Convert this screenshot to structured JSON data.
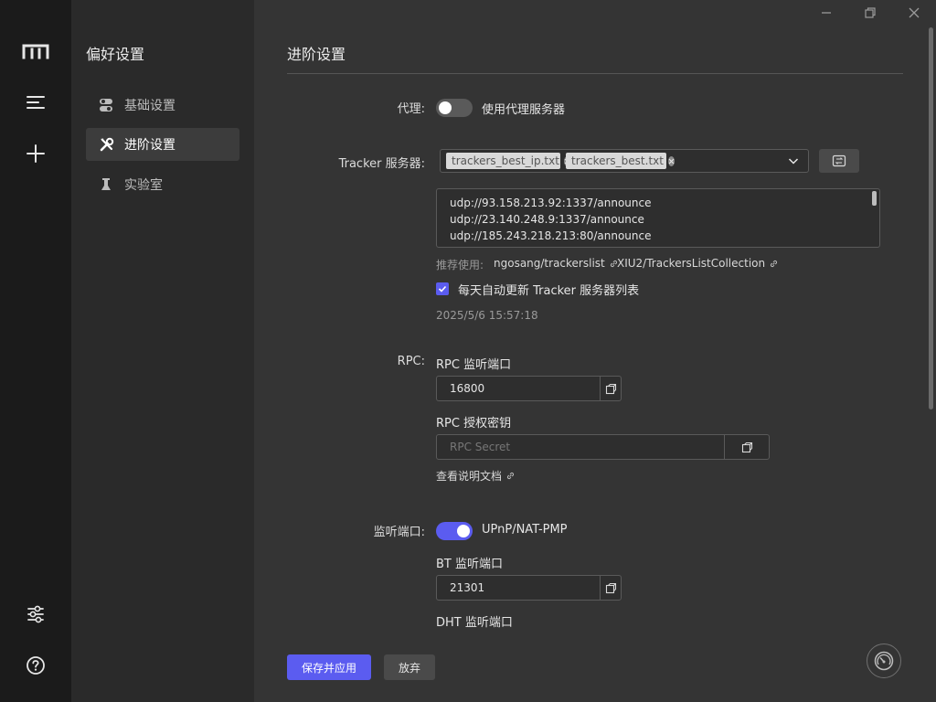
{
  "subnav": {
    "title": "偏好设置",
    "items": [
      {
        "label": "基础设置",
        "icon": "toggle-icon"
      },
      {
        "label": "进阶设置",
        "icon": "tools-icon"
      },
      {
        "label": "实验室",
        "icon": "flask-icon"
      }
    ]
  },
  "main": {
    "title": "进阶设置",
    "proxy": {
      "label": "代理:",
      "toggle_text": "使用代理服务器"
    },
    "tracker": {
      "label": "Tracker 服务器:",
      "tags": [
        "trackers_best_ip.txt",
        "trackers_best.txt"
      ],
      "lines": [
        "udp://93.158.213.92:1337/announce",
        "udp://23.140.248.9:1337/announce",
        "udp://185.243.218.213:80/announce"
      ],
      "recommend_label": "推荐使用:",
      "links": [
        "ngosang/trackerslist",
        "XIU2/TrackersListCollection"
      ],
      "auto_update": "每天自动更新 Tracker 服务器列表",
      "timestamp": "2025/5/6 15:57:18"
    },
    "rpc": {
      "label": "RPC:",
      "port_label": "RPC 监听端口",
      "port_value": "16800",
      "secret_label": "RPC 授权密钥",
      "secret_placeholder": "RPC Secret",
      "doc_link": "查看说明文档"
    },
    "listen": {
      "label": "监听端口:",
      "upnp_text": "UPnP/NAT-PMP",
      "bt_label": "BT 监听端口",
      "bt_value": "21301",
      "dht_label": "DHT 监听端口"
    },
    "buttons": {
      "save": "保存并应用",
      "discard": "放弃"
    }
  },
  "colors": {
    "accent": "#5b5cf0",
    "rail": "#1b1b1b",
    "sidebar": "#2a2a2a",
    "main": "#343434"
  }
}
